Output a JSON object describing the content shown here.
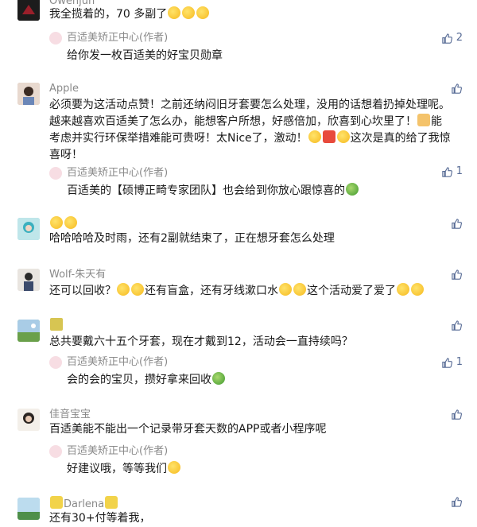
{
  "comments": [
    {
      "nickname": "Owenjun",
      "text_lines": [
        "我全揽着的，70 多副了"
      ],
      "like_count": "",
      "reply": {
        "author": "百适美矫正中心(作者)",
        "text": "给你发一枚百适美的好宝贝勋章",
        "like_count": "2"
      }
    },
    {
      "nickname": "Apple",
      "text_lines": [
        "必须要为这活动点赞！之前还纳闷旧牙套要怎么处理，没用的话想着扔掉处理呢。",
        "越来越喜欢百适美了怎么办，能想客户所想，好感倍加，欣喜到心坎里了！",
        "考虑并实行环保举措难能可贵呀！太Nice了，激动！",
        "喜呀！"
      ],
      "line2_suffix": "能",
      "line3_suffix": "这次是真的给了我惊",
      "like_count": "",
      "reply": {
        "author": "百适美矫正中心(作者)",
        "text": "百适美的【硕博正畸专家团队】也会给到你放心跟惊喜的",
        "like_count": "1"
      }
    },
    {
      "nickname": "",
      "text_lines": [
        "哈哈哈哈及时雨，还有2副就结束了，正在想牙套怎么处理"
      ],
      "like_count": "",
      "reply": null
    },
    {
      "nickname": "Wolf-朱天有",
      "text_lines": [
        "还可以回收？",
        "还有盲盒，还有牙线漱口水",
        "这个活动爱了爱了"
      ],
      "like_count": "",
      "reply": null
    },
    {
      "nickname": "",
      "text_lines": [
        "总共要戴六十五个牙套，现在才戴到12，活动会一直持续吗？"
      ],
      "like_count": "",
      "reply": {
        "author": "百适美矫正中心(作者)",
        "text": "会的会的宝贝，攒好拿来回收",
        "like_count": "1"
      }
    },
    {
      "nickname": "佳音宝宝",
      "text_lines": [
        "百适美能不能出一个记录带牙套天数的APP或者小程序呢"
      ],
      "like_count": "",
      "reply": {
        "author": "百适美矫正中心(作者)",
        "text": "好建议哦，等等我们",
        "like_count": ""
      }
    },
    {
      "nickname": "Darlena",
      "text_lines": [
        "还有30+付等着我，"
      ],
      "like_count": "",
      "reply": null
    }
  ],
  "colors": {
    "nickname": "#8a8a8a",
    "text": "#191919",
    "like": "#576b95",
    "reply_avatar": "#f7dde3"
  },
  "icons": {
    "like": "thumbs-up-icon",
    "emoji": "emoji-icon"
  }
}
